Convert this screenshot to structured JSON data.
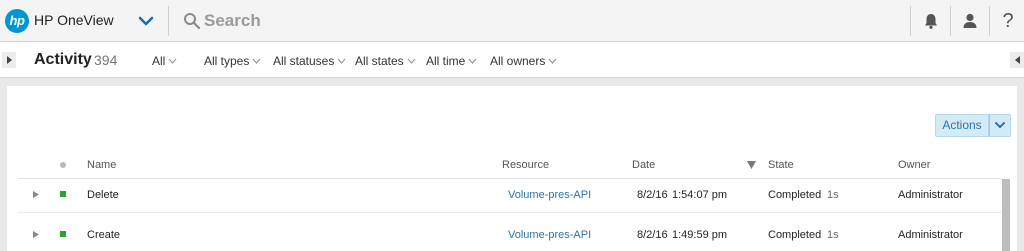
{
  "header": {
    "logo_text": "hp",
    "app_name": "HP OneView",
    "search": {
      "placeholder": "Search",
      "value": ""
    }
  },
  "activity": {
    "title": "Activity",
    "count": "394",
    "filters": [
      "All",
      "All types",
      "All statuses",
      "All states",
      "All time",
      "All owners"
    ]
  },
  "toolbar": {
    "actions_label": "Actions"
  },
  "table": {
    "columns": [
      "Name",
      "Resource",
      "Date",
      "State",
      "Owner"
    ],
    "rows": [
      {
        "name": "Delete",
        "resource": "Volume-pres-API",
        "date": "8/2/16",
        "time": "1:54:07 pm",
        "state": "Completed",
        "duration": "1s",
        "owner": "Administrator",
        "status": "ok"
      },
      {
        "name": "Create",
        "resource": "Volume-pres-API",
        "date": "8/2/16",
        "time": "1:49:59 pm",
        "state": "Completed",
        "duration": "1s",
        "owner": "Administrator",
        "status": "ok"
      }
    ]
  },
  "colors": {
    "accent": "#0096d6",
    "link": "#2b74a8",
    "status_ok": "#2fa12f",
    "button_bg": "#d3ebf7"
  },
  "icons": [
    "hp-logo-icon",
    "chevron-down-icon",
    "search-icon",
    "bell-icon",
    "user-icon",
    "help-icon",
    "sort-desc-icon",
    "expand-row-icon"
  ]
}
